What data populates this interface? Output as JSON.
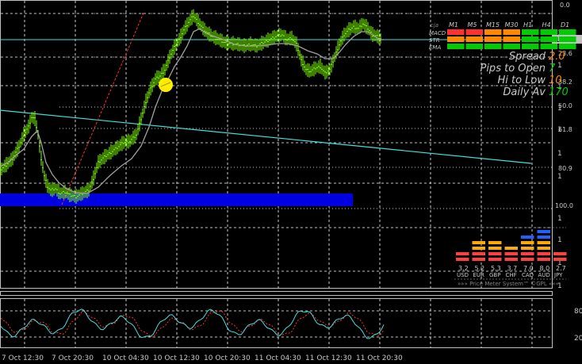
{
  "levels": {
    "top": "0.0",
    "l236": "23.6",
    "l382": "38.2",
    "l500": "50.0",
    "l618": "61.8",
    "l809": "80.9",
    "l1000": "100.0"
  },
  "price_axis_stub": "1",
  "osc_axis": {
    "upper": "80",
    "lower": "20"
  },
  "time_axis": [
    "7 Oct 12:30",
    "7 Oct 20:30",
    "10 Oct 04:30",
    "10 Oct 12:30",
    "10 Oct 20:30",
    "11 Oct 04:30",
    "11 Oct 12:30",
    "11 Oct 20:30"
  ],
  "signal_panel": {
    "corner_label": "cja",
    "timeframes": [
      "M1",
      "M5",
      "M15",
      "M30",
      "H1",
      "H4",
      "D1"
    ],
    "rows": [
      {
        "label": "MACD",
        "colors": [
          "#ff3030",
          "#ff3030",
          "#ff8800",
          "#ff8800",
          "#00cc00",
          "#00cc00",
          "#00cc00"
        ]
      },
      {
        "label": "STR",
        "colors": [
          "#ff8800",
          "#ff8800",
          "#ff8800",
          "#ff8800",
          "#00cc00",
          "#00cc00",
          "#00cc00"
        ]
      },
      {
        "label": "EMA",
        "colors": [
          "#00cc00",
          "#00cc00",
          "#00cc00",
          "#00cc00",
          "#00cc00",
          "#00cc00",
          "#00cc00"
        ]
      }
    ]
  },
  "info": [
    {
      "label": "Spread",
      "value": "2.0",
      "color": "#ff8800"
    },
    {
      "label": "Pips to Open",
      "value": "7",
      "color": "#00cc00"
    },
    {
      "label": "Hi to Low",
      "value": "10",
      "color": "#ff8800"
    },
    {
      "label": "Daily Av",
      "value": "170",
      "color": "#00cc00"
    }
  ],
  "price_meter": {
    "currencies": [
      "USD",
      "EUR",
      "GBP",
      "CHF",
      "CAD",
      "AUD",
      "JPY"
    ],
    "values": [
      "3.2",
      "5.2",
      "5.3",
      "3.7",
      "7.0",
      "8.0",
      "2.7"
    ],
    "strength": [
      3.2,
      5.2,
      5.3,
      3.7,
      7.0,
      8.0,
      2.7
    ],
    "footer": "»»» Price Meter System™ ©GPL «««"
  },
  "colors": {
    "price_line": "#7fff00",
    "ma_line": "#a0a0a0",
    "trend_line": "#40e0e0",
    "fib_line": "#ff3030",
    "zone": "#0000e0",
    "marker": "#ffee00",
    "grid": "#ffffff"
  }
}
